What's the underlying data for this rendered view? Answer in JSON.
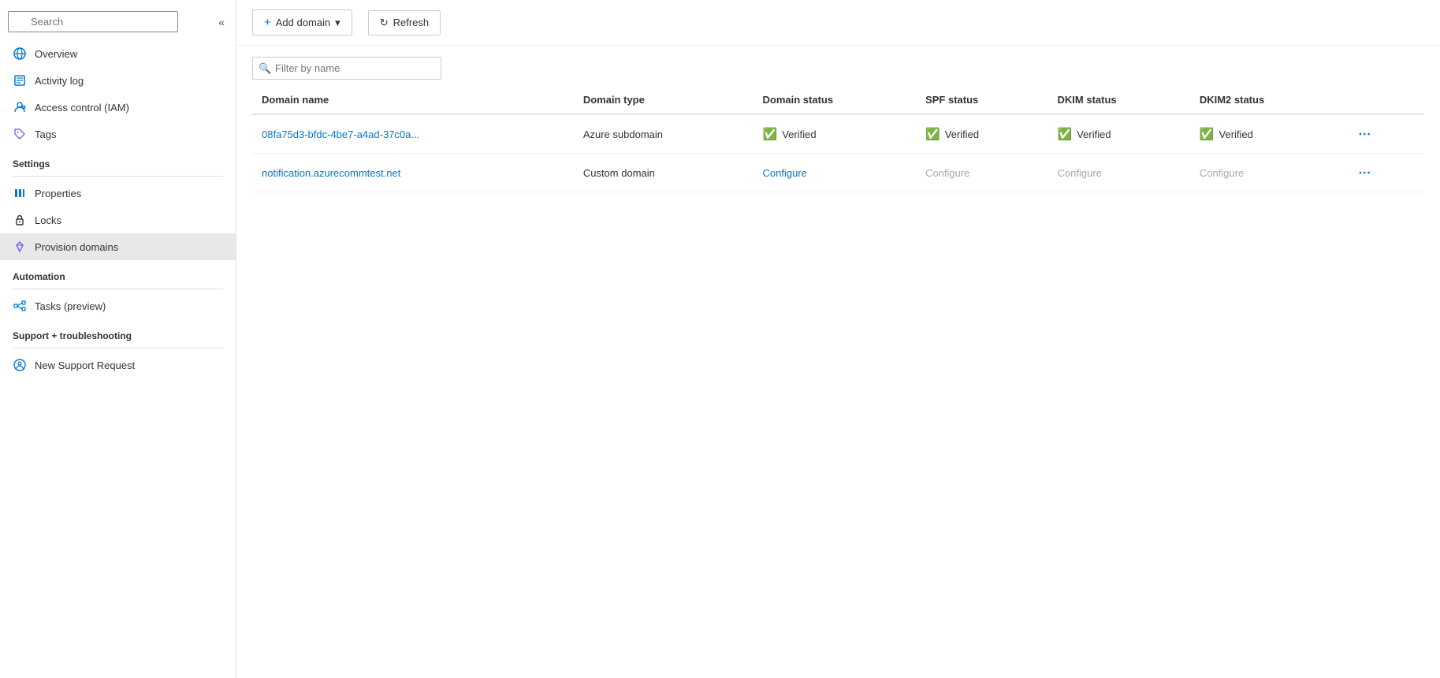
{
  "sidebar": {
    "search_placeholder": "Search",
    "items_top": [
      {
        "id": "overview",
        "label": "Overview",
        "icon": "globe"
      },
      {
        "id": "activity-log",
        "label": "Activity log",
        "icon": "list"
      },
      {
        "id": "access-control",
        "label": "Access control (IAM)",
        "icon": "person"
      },
      {
        "id": "tags",
        "label": "Tags",
        "icon": "tag"
      }
    ],
    "section_settings": "Settings",
    "items_settings": [
      {
        "id": "properties",
        "label": "Properties",
        "icon": "bars"
      },
      {
        "id": "locks",
        "label": "Locks",
        "icon": "lock"
      },
      {
        "id": "provision-domains",
        "label": "Provision domains",
        "icon": "diamond",
        "active": true
      }
    ],
    "section_automation": "Automation",
    "items_automation": [
      {
        "id": "tasks",
        "label": "Tasks (preview)",
        "icon": "nodes"
      }
    ],
    "section_support": "Support + troubleshooting",
    "items_support": [
      {
        "id": "new-support",
        "label": "New Support Request",
        "icon": "person-circle"
      }
    ]
  },
  "toolbar": {
    "add_domain_label": "Add domain",
    "add_domain_chevron": "▾",
    "refresh_label": "Refresh"
  },
  "filter": {
    "placeholder": "Filter by name"
  },
  "table": {
    "columns": [
      {
        "id": "domain-name",
        "label": "Domain name"
      },
      {
        "id": "domain-type",
        "label": "Domain type"
      },
      {
        "id": "domain-status",
        "label": "Domain status"
      },
      {
        "id": "spf-status",
        "label": "SPF status"
      },
      {
        "id": "dkim-status",
        "label": "DKIM status"
      },
      {
        "id": "dkim2-status",
        "label": "DKIM2 status"
      }
    ],
    "rows": [
      {
        "domain_name": "08fa75d3-bfdc-4be7-a4ad-37c0a...",
        "domain_type": "Azure subdomain",
        "domain_status": "Verified",
        "domain_status_type": "verified",
        "spf_status": "Verified",
        "spf_status_type": "verified",
        "dkim_status": "Verified",
        "dkim_status_type": "verified",
        "dkim2_status": "Verified",
        "dkim2_status_type": "verified"
      },
      {
        "domain_name": "notification.azurecommtest.net",
        "domain_type": "Custom domain",
        "domain_status": "Configure",
        "domain_status_type": "configure-active",
        "spf_status": "Configure",
        "spf_status_type": "configure-inactive",
        "dkim_status": "Configure",
        "dkim_status_type": "configure-inactive",
        "dkim2_status": "Configure",
        "dkim2_status_type": "configure-inactive"
      }
    ]
  }
}
